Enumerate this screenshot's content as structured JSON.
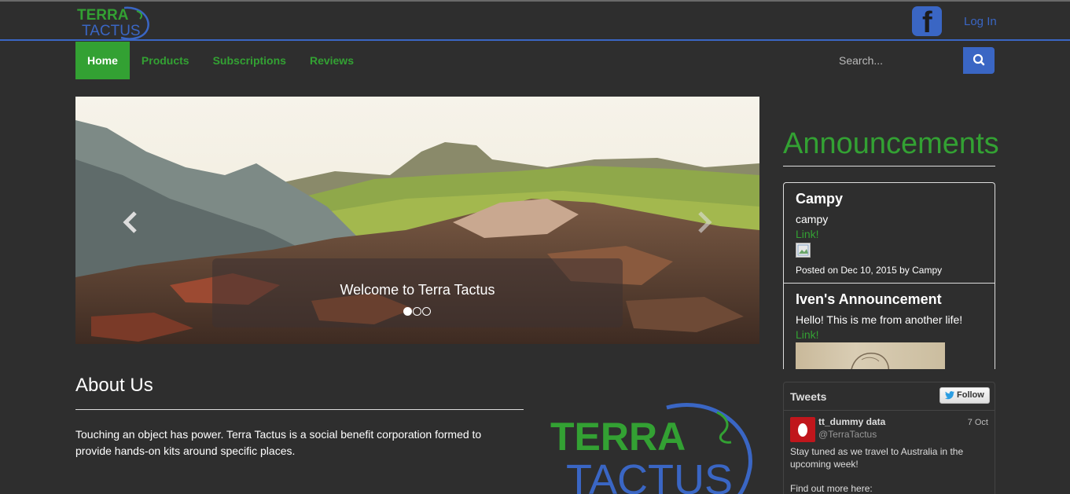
{
  "header": {
    "logo_alt": "TERRA TACTUS",
    "logo_line1": "TERRA",
    "logo_line2": "TACTUS",
    "facebook_icon": "facebook-icon",
    "login_label": "Log In"
  },
  "nav": {
    "items": [
      {
        "label": "Home",
        "active": true
      },
      {
        "label": "Products",
        "active": false
      },
      {
        "label": "Subscriptions",
        "active": false
      },
      {
        "label": "Reviews",
        "active": false
      }
    ],
    "search_placeholder": "Search...",
    "search_icon": "search-icon"
  },
  "carousel": {
    "caption": "Welcome to Terra Tactus",
    "slide_count": 3,
    "active_slide": 1
  },
  "about": {
    "title": "About Us",
    "text": "Touching an object has power. Terra Tactus is a social benefit corporation formed to provide hands-on kits around specific places."
  },
  "announcements": {
    "title": "Announcements",
    "items": [
      {
        "title": "Campy",
        "body": "campy",
        "link": "Link!",
        "meta": "Posted on Dec 10, 2015 by Campy"
      },
      {
        "title": "Iven's Announcement",
        "body": "Hello! This is me from another life!",
        "link": "Link!"
      }
    ]
  },
  "tweets": {
    "title": "Tweets",
    "follow_label": "Follow",
    "tweet": {
      "name": "tt_dummy data",
      "handle": "@TerraTactus",
      "date": "7 Oct",
      "text": "Stay tuned as we travel to Australia in the upcoming week!",
      "more": "Find out more here:"
    }
  },
  "colors": {
    "background": "#2e2e2e",
    "accent_green": "#33a133",
    "accent_blue": "#3a66c4"
  }
}
